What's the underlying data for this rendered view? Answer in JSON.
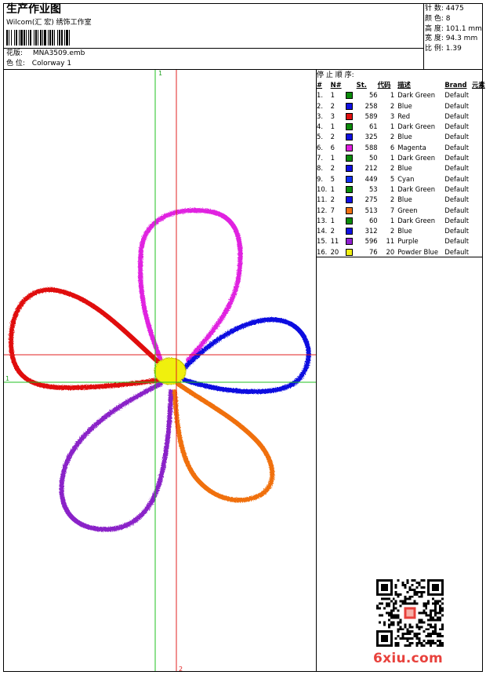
{
  "header": {
    "title": "生产作业图",
    "subtitle": "Wilcom(汇 宏) 绣饰工作室",
    "design_label": "花版:",
    "design_value": "MNA3509.emb",
    "colorway_label": "色 位:",
    "colorway_value": "Colorway 1"
  },
  "stats": {
    "stitches_label": "针 数:",
    "stitches_value": "4475",
    "colors_label": "颜 色:",
    "colors_value": "8",
    "height_label": "高 度:",
    "height_value": "101.1 mm",
    "width_label": "宽 度:",
    "width_value": "94.3 mm",
    "scale_label": "比 例:",
    "scale_value": "1.39"
  },
  "guides": {
    "top_marker": "1",
    "left_marker": "1",
    "bottom_marker": "2"
  },
  "stop_sequence": {
    "title": "停 止 顺 序:",
    "headers": [
      "#",
      "N#",
      "St.",
      "代码",
      "描述",
      "Brand",
      "元素"
    ],
    "rows": [
      {
        "n": "1.",
        "needle": "1",
        "stitches": "56",
        "code": "1",
        "desc": "Dark Green",
        "brand": "Default",
        "color": "#0a8a0a"
      },
      {
        "n": "2.",
        "needle": "2",
        "stitches": "258",
        "code": "2",
        "desc": "Blue",
        "brand": "Default",
        "color": "#1010e0"
      },
      {
        "n": "3.",
        "needle": "3",
        "stitches": "589",
        "code": "3",
        "desc": "Red",
        "brand": "Default",
        "color": "#e01010"
      },
      {
        "n": "4.",
        "needle": "1",
        "stitches": "61",
        "code": "1",
        "desc": "Dark Green",
        "brand": "Default",
        "color": "#0a8a0a"
      },
      {
        "n": "5.",
        "needle": "2",
        "stitches": "325",
        "code": "2",
        "desc": "Blue",
        "brand": "Default",
        "color": "#1010e0"
      },
      {
        "n": "6.",
        "needle": "6",
        "stitches": "588",
        "code": "6",
        "desc": "Magenta",
        "brand": "Default",
        "color": "#e020e0"
      },
      {
        "n": "7.",
        "needle": "1",
        "stitches": "50",
        "code": "1",
        "desc": "Dark Green",
        "brand": "Default",
        "color": "#0a8a0a"
      },
      {
        "n": "8.",
        "needle": "2",
        "stitches": "212",
        "code": "2",
        "desc": "Blue",
        "brand": "Default",
        "color": "#1010e0"
      },
      {
        "n": "9.",
        "needle": "5",
        "stitches": "449",
        "code": "5",
        "desc": "Cyan",
        "brand": "Default",
        "color": "#1030f0"
      },
      {
        "n": "10.",
        "needle": "1",
        "stitches": "53",
        "code": "1",
        "desc": "Dark Green",
        "brand": "Default",
        "color": "#0a8a0a"
      },
      {
        "n": "11.",
        "needle": "2",
        "stitches": "275",
        "code": "2",
        "desc": "Blue",
        "brand": "Default",
        "color": "#1010e0"
      },
      {
        "n": "12.",
        "needle": "7",
        "stitches": "513",
        "code": "7",
        "desc": "Green",
        "brand": "Default",
        "color": "#f07010"
      },
      {
        "n": "13.",
        "needle": "1",
        "stitches": "60",
        "code": "1",
        "desc": "Dark Green",
        "brand": "Default",
        "color": "#0a8a0a"
      },
      {
        "n": "14.",
        "needle": "2",
        "stitches": "312",
        "code": "2",
        "desc": "Blue",
        "brand": "Default",
        "color": "#1010e0"
      },
      {
        "n": "15.",
        "needle": "11",
        "stitches": "596",
        "code": "11",
        "desc": "Purple",
        "brand": "Default",
        "color": "#9020d0"
      },
      {
        "n": "16.",
        "needle": "20",
        "stitches": "76",
        "code": "20",
        "desc": "Powder Blue",
        "brand": "Default",
        "color": "#f0f010"
      }
    ]
  },
  "petal_colors": {
    "top": "#e020e0",
    "left": "#e01010",
    "right": "#1010e0",
    "bottom_left": "#8a20c8",
    "bottom_right": "#f07010",
    "center": "#f0f010"
  },
  "guide_colors": {
    "green": "#20c020",
    "red": "#e02020"
  },
  "watermark": "6xiu.com"
}
